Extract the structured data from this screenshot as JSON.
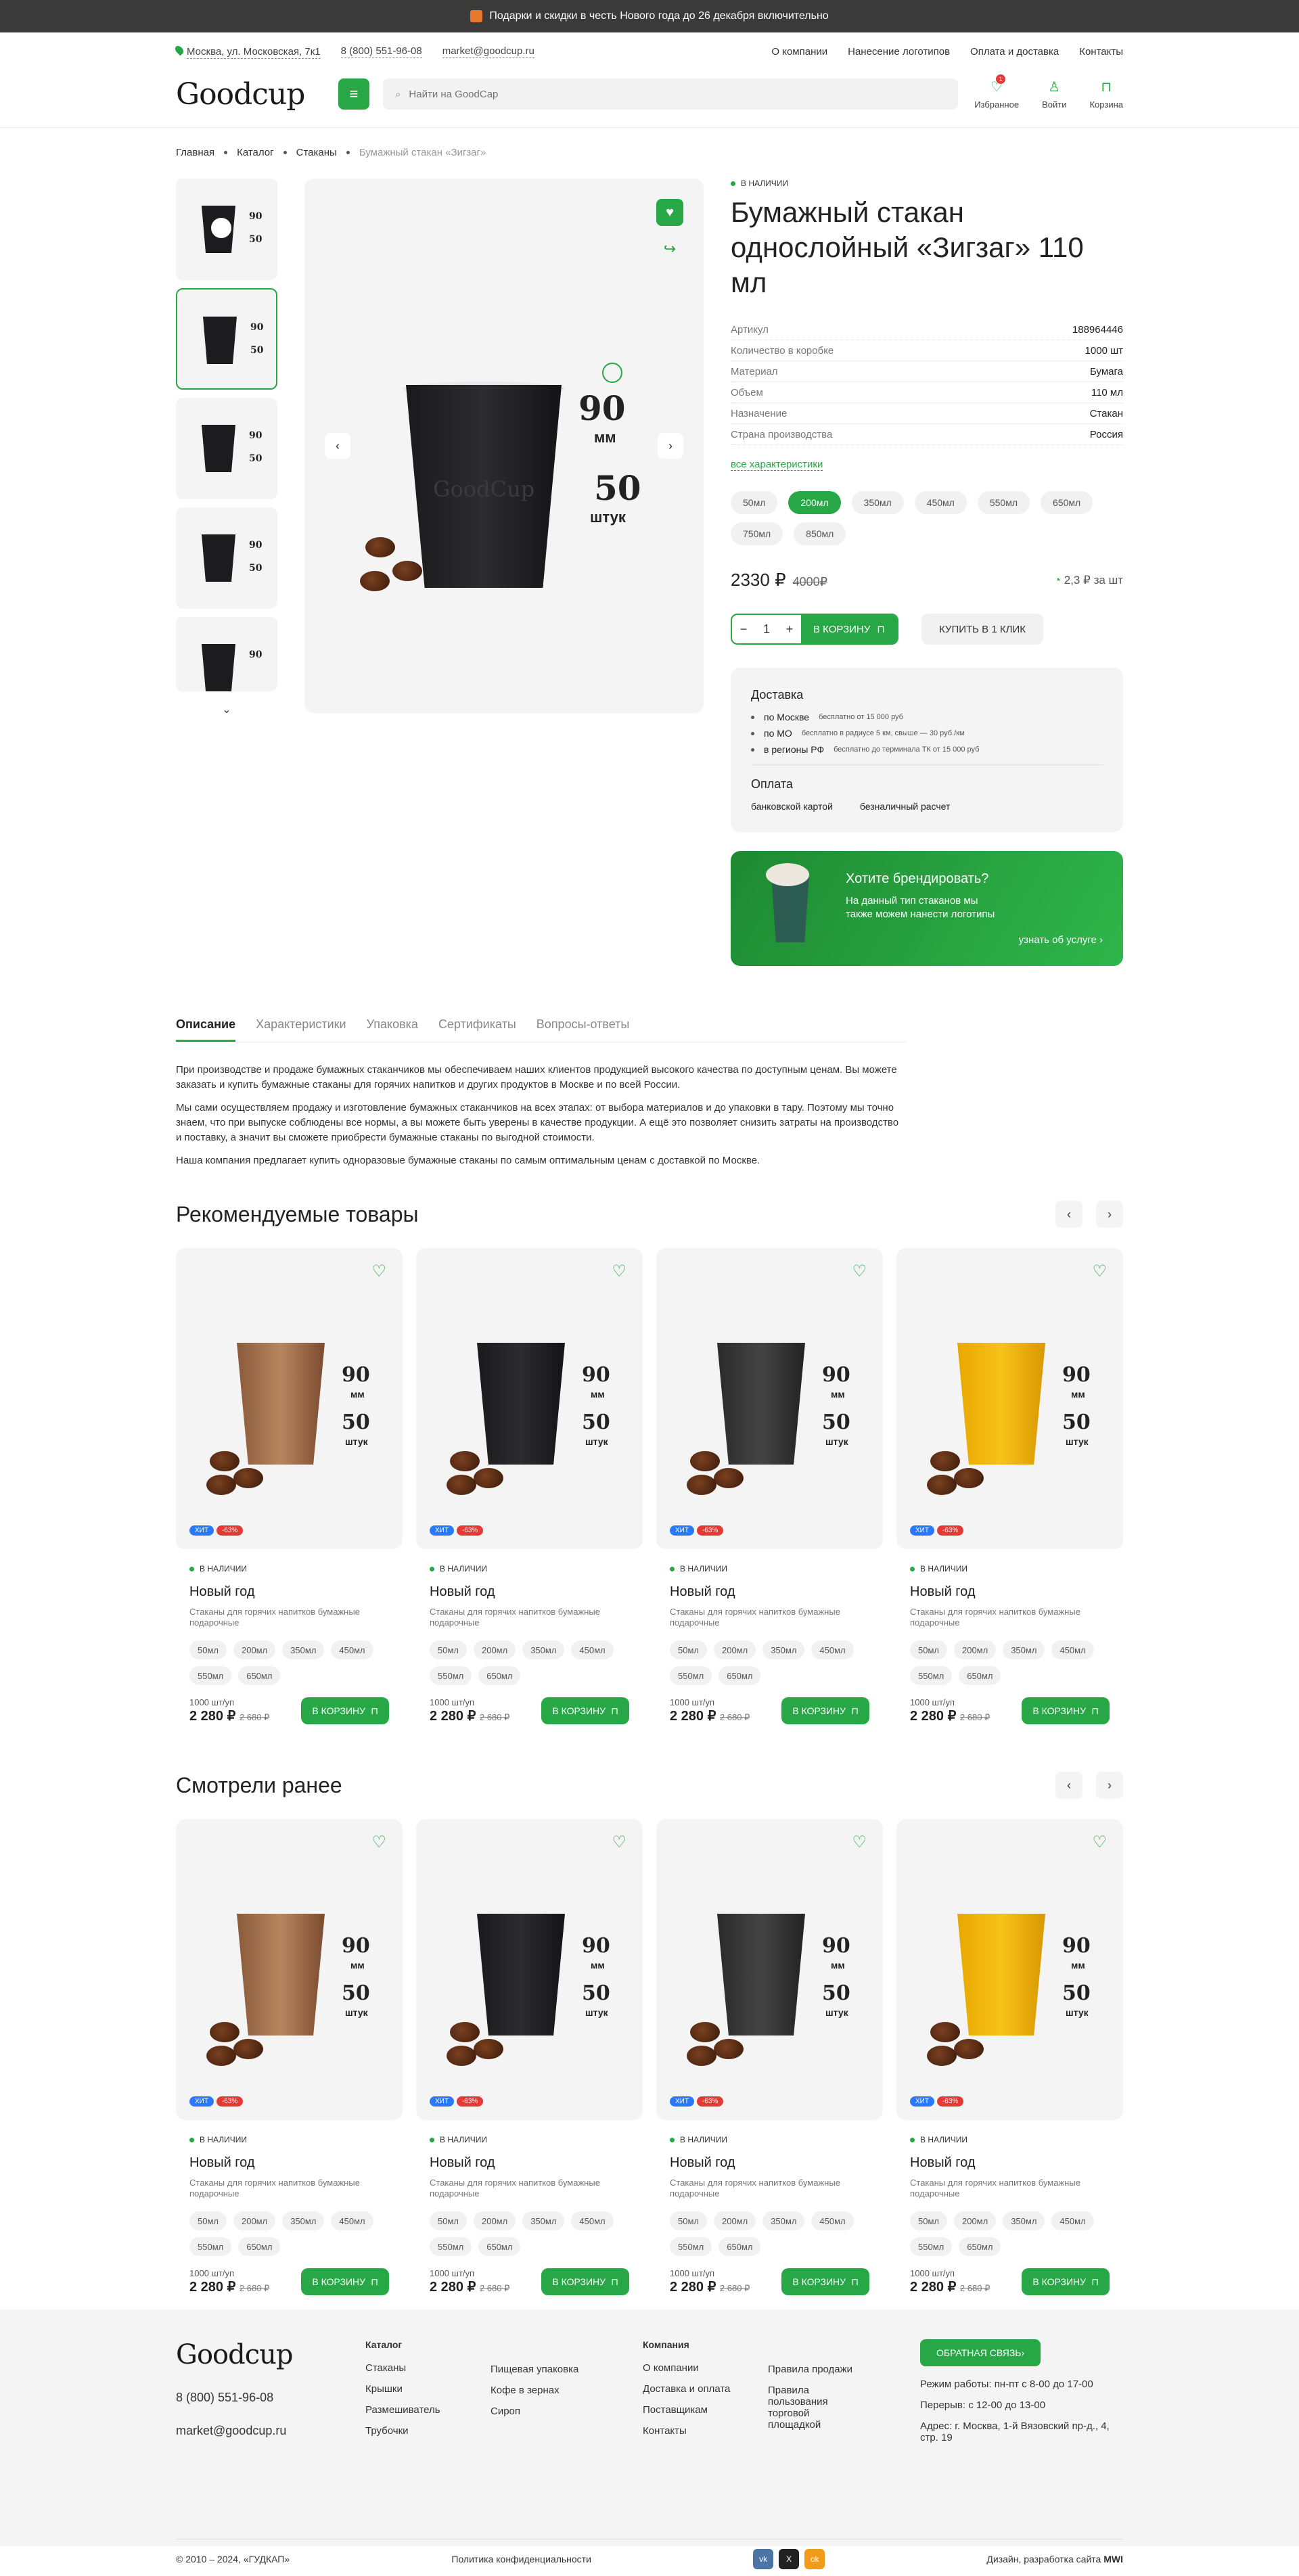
{
  "topbar": {
    "text": "Подарки и скидки в честь Нового года до 26 декабря включительно"
  },
  "header": {
    "address": "Москва, ул. Московская, 7к1",
    "phone": "8 (800) 551-96-08",
    "email": "market@goodcup.ru",
    "menu": [
      "О компании",
      "Нанесение логотипов",
      "Оплата и доставка",
      "Контакты"
    ],
    "logo": "Goodcup",
    "search_placeholder": "Найти на GoodCap",
    "fav_label": "Избранное",
    "fav_count": "1",
    "login_label": "Войти",
    "cart_label": "Корзина"
  },
  "breadcrumb": [
    "Главная",
    "Каталог",
    "Стаканы",
    "Бумажный стакан «Зигзаг»"
  ],
  "product": {
    "stock": "В НАЛИЧИИ",
    "title": "Бумажный стакан однослойный «Зигзаг» 110 мл",
    "props": [
      {
        "k": "Артикул",
        "v": "188964446"
      },
      {
        "k": "Количество в коробке",
        "v": "1000 шт"
      },
      {
        "k": "Материал",
        "v": "Бумага"
      },
      {
        "k": "Объем",
        "v": "110 мл"
      },
      {
        "k": "Назначение",
        "v": "Стакан"
      },
      {
        "k": "Страна производства",
        "v": "Россия"
      }
    ],
    "all_chars": "все характеристики",
    "sizes": [
      "50мл",
      "200мл",
      "350мл",
      "450мл",
      "550мл",
      "650мл",
      "750мл",
      "850мл"
    ],
    "active_size": "200мл",
    "price": "2330 ₽",
    "old_price": "4000₽",
    "per_unit": "2,3 ₽ за шт",
    "qty": "1",
    "cart_btn": "В КОРЗИНУ",
    "oneclick": "КУПИТЬ В 1 КЛИК",
    "gallery_num1": "90",
    "gallery_unit1": "мм",
    "gallery_num2": "50",
    "gallery_unit2": "штук",
    "gallery_brand": "GoodCup"
  },
  "delivery": {
    "title": "Доставка",
    "items": [
      {
        "place": "по Москве",
        "note": "бесплатно от 15 000 руб"
      },
      {
        "place": "по МО",
        "note": "бесплатно в радиусе 5 км, свыше — 30 руб./км"
      },
      {
        "place": "в регионы РФ",
        "note": "бесплатно до терминала ТК от 15 000 руб"
      }
    ],
    "pay_title": "Оплата",
    "pay": [
      "банковской картой",
      "безналичный расчет"
    ]
  },
  "branding": {
    "title": "Хотите брендировать?",
    "text": "На данный тип стаканов мы также можем нанести логотипы",
    "more": "узнать об услуге"
  },
  "tabs": [
    "Описание",
    "Характеристики",
    "Упаковка",
    "Сертификаты",
    "Вопросы-ответы"
  ],
  "description": [
    "При производстве и продаже бумажных стаканчиков мы обеспечиваем наших клиентов продукцией высокого качества по доступным ценам. Вы можете заказать и купить бумажные стаканы для горячих напитков и других продуктов в Москве и по всей России.",
    "Мы сами осуществляем продажу и изготовление бумажных стаканчиков на всех этапах: от выбора материалов и до упаковки в тару. Поэтому мы точно знаем, что при выпуске соблюдены все нормы, а вы можете быть уверены в качестве продукции. А ещё это позволяет снизить затраты на производство и поставку, а значит вы сможете приобрести бумажные стаканы по выгодной стоимости.",
    "Наша компания предлагает купить одноразовые бумажные стаканы по самым оптимальным ценам с доставкой по Москве."
  ],
  "recommended": {
    "title": "Рекомендуемые товары"
  },
  "viewed": {
    "title": "Смотрели ранее"
  },
  "card": {
    "stock": "В НАЛИЧИИ",
    "name": "Новый год",
    "desc": "Стаканы для горячих напитков бумажные подарочные",
    "sizes": [
      "50мл",
      "200мл",
      "350мл",
      "450мл",
      "550мл",
      "650мл"
    ],
    "pack": "1000 шт/уп",
    "price": "2 280 ₽",
    "old": "2 680 ₽",
    "btn": "В КОРЗИНУ",
    "tag_hit": "ХИТ",
    "tag_sale": "-63%",
    "n90": "90",
    "mm": "мм",
    "n50": "50",
    "sht": "штук"
  },
  "footer": {
    "logo": "Goodcup",
    "phone": "8 (800) 551-96-08",
    "email": "market@goodcup.ru",
    "catalog_title": "Каталог",
    "catalog1": [
      "Стаканы",
      "Крышки",
      "Размешиватель",
      "Трубочки"
    ],
    "catalog2": [
      "Пищевая упаковка",
      "Кофе в зернах",
      "Сироп"
    ],
    "company_title": "Компания",
    "company1": [
      "О компании",
      "Доставка и оплата",
      "Поставщикам",
      "Контакты"
    ],
    "company2": [
      "Правила продажи",
      "Правила пользования торговой площадкой"
    ],
    "feedback": "ОБРАТНАЯ СВЯЗЬ",
    "hours": "Режим работы: пн-пт с 8-00 до 17-00",
    "break": "Перерыв: с 12-00 до 13-00",
    "address": "Адрес: г. Москва, 1-й Вязовский пр-д., 4, стр. 19",
    "copy": "© 2010 – 2024, «ГУДКАП»",
    "policy": "Политика конфиденциальности",
    "dev": "Дизайн, разработка сайта",
    "dev_brand": "MWI"
  }
}
